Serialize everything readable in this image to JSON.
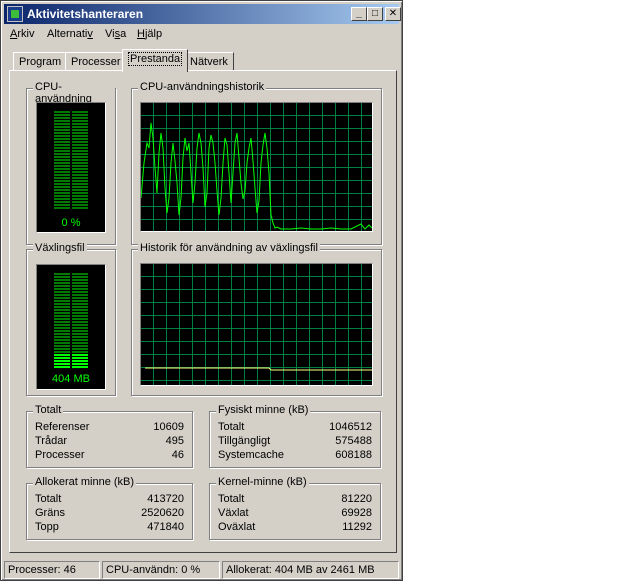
{
  "window": {
    "title": "Aktivitetshanteraren"
  },
  "titlebar_buttons": {
    "minimize": "_",
    "maximize": "□",
    "close": "✕"
  },
  "menu": {
    "arkiv": {
      "accel": "A",
      "rest": "rkiv"
    },
    "alternativ": {
      "pre": "Alternati",
      "accel": "v"
    },
    "visa": {
      "pre": "Vi",
      "accel": "s",
      "post": "a"
    },
    "hjalp": {
      "accel": "H",
      "rest": "jälp"
    }
  },
  "tabs": [
    "Program",
    "Processer",
    "Prestanda",
    "Nätverk"
  ],
  "active_tab": "Prestanda",
  "performance": {
    "cpu_usage": {
      "label": "CPU-användning",
      "value": "0 %",
      "level": 0.0
    },
    "cpu_history": {
      "label": "CPU-användningshistorik"
    },
    "pagefile": {
      "label": "Växlingsfil",
      "value": "404 MB",
      "level": 0.16
    },
    "pagefile_history": {
      "label": "Historik för användning av växlingsfil"
    }
  },
  "totals": {
    "label": "Totalt",
    "rows": [
      {
        "name": "Referenser",
        "value": "10609"
      },
      {
        "name": "Trådar",
        "value": "495"
      },
      {
        "name": "Processer",
        "value": "46"
      }
    ]
  },
  "physical_memory": {
    "label": "Fysiskt minne (kB)",
    "rows": [
      {
        "name": "Totalt",
        "value": "1046512"
      },
      {
        "name": "Tillgängligt",
        "value": "575488"
      },
      {
        "name": "Systemcache",
        "value": "608188"
      }
    ]
  },
  "commit_charge": {
    "label": "Allokerat minne (kB)",
    "rows": [
      {
        "name": "Totalt",
        "value": "413720"
      },
      {
        "name": "Gräns",
        "value": "2520620"
      },
      {
        "name": "Topp",
        "value": "471840"
      }
    ]
  },
  "kernel_memory": {
    "label": "Kernel-minne (kB)",
    "rows": [
      {
        "name": "Totalt",
        "value": "81220"
      },
      {
        "name": "Växlat",
        "value": "69928"
      },
      {
        "name": "Oväxlat",
        "value": "11292"
      }
    ]
  },
  "status_bar": {
    "processes": "Processer: 46",
    "cpu": "CPU-användn: 0 %",
    "commit": "Allokerat: 404 MB av 2461 MB"
  },
  "colors": {
    "graph_green": "#00ff00",
    "grid": "#008040",
    "dark_green": "#007a00"
  }
}
